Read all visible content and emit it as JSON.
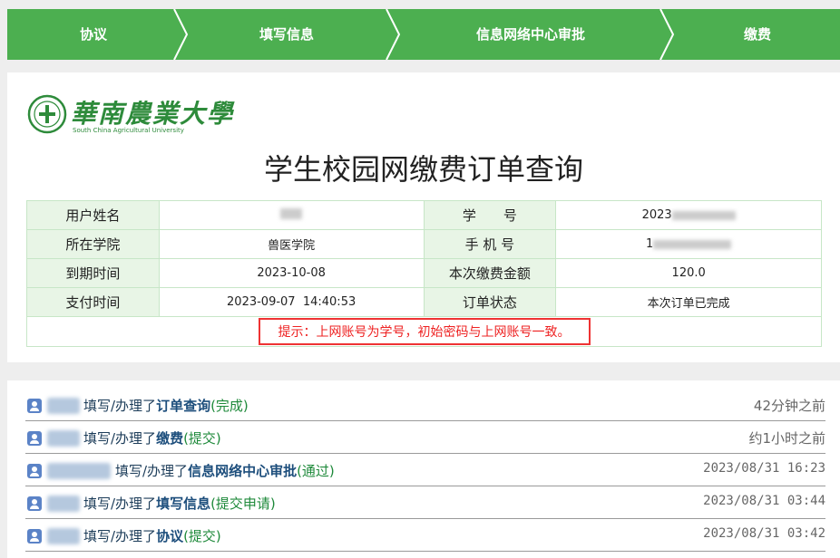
{
  "steps": [
    "协议",
    "填写信息",
    "信息网络中心审批",
    "缴费"
  ],
  "logo": {
    "cn": "華南農業大學",
    "en": "South China Agricultural University"
  },
  "title": "学生校园网缴费订单查询",
  "info": {
    "name_label": "用户姓名",
    "name_value": "",
    "sid_label": "学　　号",
    "sid_value": "2023",
    "college_label": "所在学院",
    "college_value": "兽医学院",
    "phone_label": "手 机 号",
    "phone_value": "1",
    "expire_label": "到期时间",
    "expire_value": "2023-10-08",
    "amount_label": "本次缴费金额",
    "amount_value": "120.0",
    "paytime_label": "支付时间",
    "paytime_value": "2023-09-07  14:40:53",
    "status_label": "订单状态",
    "status_value": "本次订单已完成",
    "tip": "提示：上网账号为学号，初始密码与上网账号一致。"
  },
  "activity": [
    {
      "prefix": "填写/办理了",
      "action": "订单查询",
      "status": "(完成)",
      "time": "42分钟之前"
    },
    {
      "prefix": "填写/办理了",
      "action": "缴费",
      "status": "(提交)",
      "time": "约1小时之前"
    },
    {
      "prefix": "填写/办理了",
      "action": "信息网络中心审批",
      "status": "(通过)",
      "time": "2023/08/31 16:23"
    },
    {
      "prefix": "填写/办理了",
      "action": "填写信息",
      "status": "(提交申请)",
      "time": "2023/08/31 03:44"
    },
    {
      "prefix": "填写/办理了",
      "action": "协议",
      "status": "(提交)",
      "time": "2023/08/31 03:42"
    }
  ],
  "colors": {
    "step_bar": "#4caf50",
    "label_bg": "#e8f5e6",
    "tip_border": "#e33333",
    "logo_green": "#2e8b3b"
  }
}
